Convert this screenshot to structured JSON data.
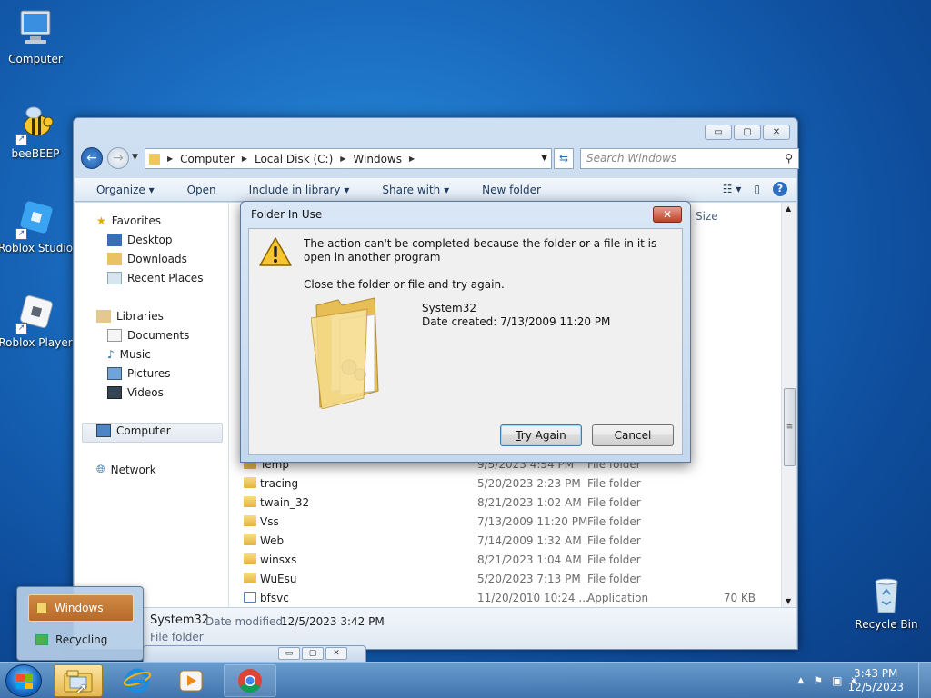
{
  "desktop": {
    "icons": [
      {
        "label": "Computer"
      },
      {
        "label": "beeBEEP"
      },
      {
        "label": "Roblox Studio"
      },
      {
        "label": "Roblox Player"
      },
      {
        "label": "Recycle Bin"
      }
    ]
  },
  "explorer": {
    "window_buttons": {
      "minimize": "▭",
      "maximize": "▢",
      "close": "✕"
    },
    "breadcrumb": [
      "Computer",
      "Local Disk (C:)",
      "Windows"
    ],
    "search_placeholder": "Search Windows",
    "toolbar": {
      "organize": "Organize",
      "open": "Open",
      "include": "Include in library",
      "share": "Share with",
      "new_folder": "New folder"
    },
    "nav": {
      "favorites": "Favorites",
      "desktop": "Desktop",
      "downloads": "Downloads",
      "recent": "Recent Places",
      "libraries": "Libraries",
      "documents": "Documents",
      "music": "Music",
      "pictures": "Pictures",
      "videos": "Videos",
      "computer": "Computer",
      "network": "Network"
    },
    "column_size": "Size",
    "files": [
      {
        "name": "Temp",
        "date": "9/5/2023 4:54 PM",
        "type": "File folder",
        "size": ""
      },
      {
        "name": "tracing",
        "date": "5/20/2023 2:23 PM",
        "type": "File folder",
        "size": ""
      },
      {
        "name": "twain_32",
        "date": "8/21/2023 1:02 AM",
        "type": "File folder",
        "size": ""
      },
      {
        "name": "Vss",
        "date": "7/13/2009 11:20 PM",
        "type": "File folder",
        "size": ""
      },
      {
        "name": "Web",
        "date": "7/14/2009 1:32 AM",
        "type": "File folder",
        "size": ""
      },
      {
        "name": "winsxs",
        "date": "8/21/2023 1:04 AM",
        "type": "File folder",
        "size": ""
      },
      {
        "name": "WuEsu",
        "date": "5/20/2023 7:13 PM",
        "type": "File folder",
        "size": ""
      },
      {
        "name": "bfsvc",
        "date": "11/20/2010 10:24 ...",
        "type": "Application",
        "size": "70 KB"
      }
    ],
    "details": {
      "name": "System32",
      "modified_label": "Date modified:",
      "modified": "12/5/2023 3:42 PM",
      "type": "File folder"
    }
  },
  "dialog": {
    "title": "Folder In Use",
    "message": "The action can't be completed because the folder or a file in it is open in another program",
    "instruction": "Close the folder or file and try again.",
    "item_name": "System32",
    "item_date": "Date created: 7/13/2009 11:20 PM",
    "try_again_prefix": "",
    "try_again_u": "T",
    "try_again_rest": "ry Again",
    "cancel": "Cancel"
  },
  "popup": {
    "items": [
      {
        "label": "Windows"
      },
      {
        "label": "Recycling"
      }
    ]
  },
  "taskbar": {
    "time": "3:43 PM",
    "date": "12/5/2023"
  },
  "colors": {
    "desktop": "#1a6cc0",
    "selected_popup": "#c17835"
  }
}
